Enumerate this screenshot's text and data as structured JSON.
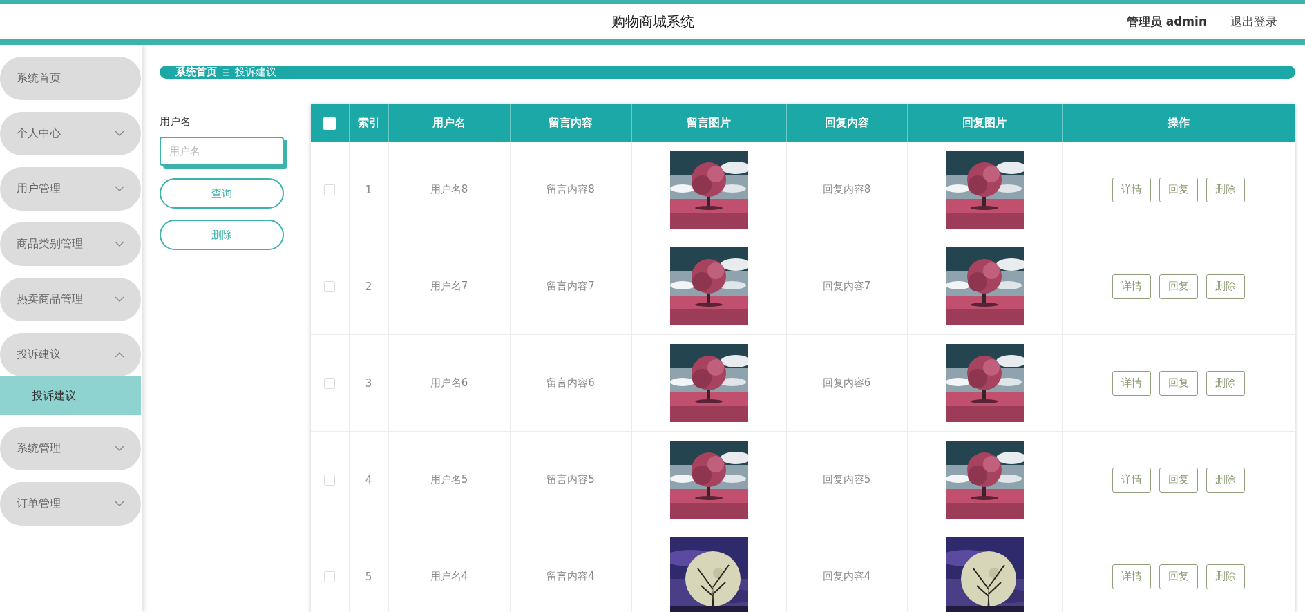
{
  "header": {
    "title": "购物商城系统",
    "user": "管理员 admin",
    "logout": "退出登录"
  },
  "sidebar": {
    "items": [
      {
        "label": "系统首页",
        "selected": false
      },
      {
        "label": "个人中心",
        "expanded": false,
        "selected": false
      },
      {
        "label": "用户管理",
        "expanded": false,
        "selected": false
      },
      {
        "label": "商品类别管理",
        "expanded": false,
        "selected": false
      },
      {
        "label": "热卖商品管理",
        "expanded": false,
        "selected": false
      },
      {
        "label": "投诉建议",
        "expanded": true,
        "selected": false,
        "children": [
          {
            "label": "投诉建议",
            "selected": true
          }
        ]
      },
      {
        "label": "系统管理",
        "expanded": false,
        "selected": false
      },
      {
        "label": "订单管理",
        "expanded": false,
        "selected": false
      }
    ]
  },
  "breadcrumb": [
    "系统首页",
    "投诉建议"
  ],
  "search": {
    "label": "用户名",
    "placeholder": "用户名",
    "buttons": [
      "查询",
      "删除"
    ]
  },
  "table": {
    "select_all_checked": false,
    "columns": [
      "索引",
      "用户名",
      "留言内容",
      "留言图片",
      "回复内容",
      "回复图片",
      "操作"
    ],
    "rows": [
      {
        "index": "1",
        "username": "用户名8",
        "message": "留言内容8",
        "reply": "回复内容8",
        "checked": false,
        "actions": [
          "详情",
          "回复",
          "删除"
        ]
      },
      {
        "index": "2",
        "username": "用户名7",
        "message": "留言内容7",
        "reply": "回复内容7",
        "checked": false,
        "actions": [
          "详情",
          "回复",
          "删除"
        ]
      },
      {
        "index": "3",
        "username": "用户名6",
        "message": "留言内容6",
        "reply": "回复内容6",
        "checked": false,
        "actions": [
          "详情",
          "回复",
          "删除"
        ]
      },
      {
        "index": "4",
        "username": "用户名5",
        "message": "留言内容5",
        "reply": "回复内容5",
        "checked": false,
        "actions": [
          "详情",
          "回复",
          "删除"
        ]
      },
      {
        "index": "5",
        "username": "用户名4",
        "message": "留言内容4",
        "reply": "回复内容4",
        "checked": false,
        "actions": [
          "详情",
          "回复",
          "删除"
        ]
      }
    ]
  }
}
